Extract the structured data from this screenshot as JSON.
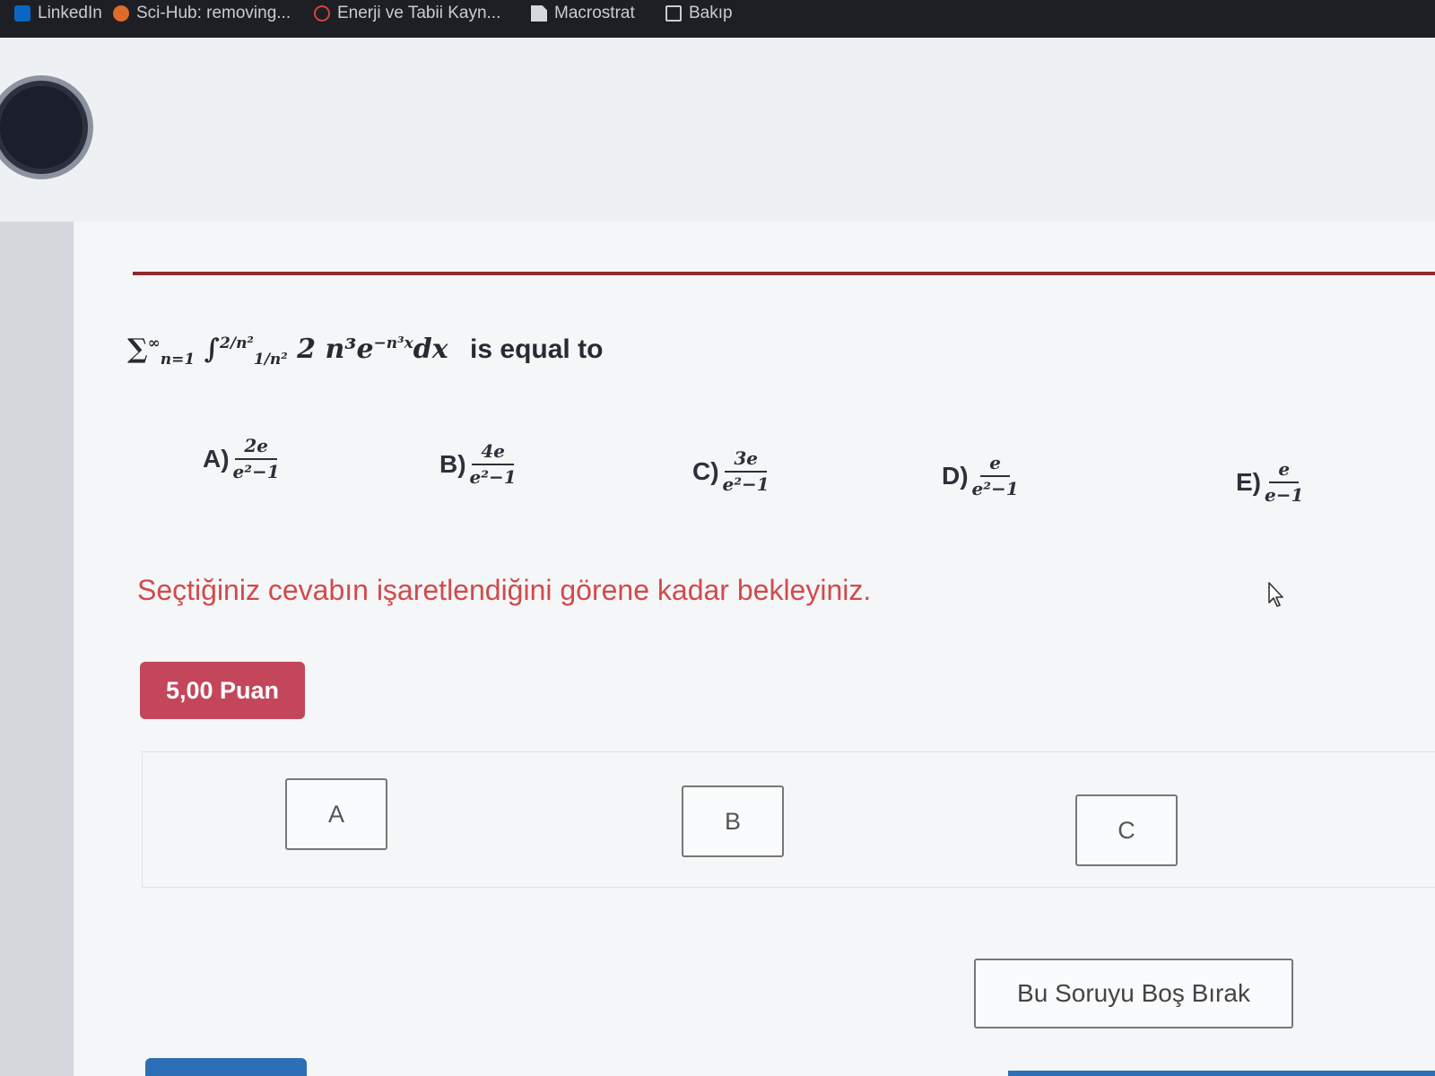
{
  "bookmarks": [
    {
      "label": "LinkedIn",
      "icon": "linkedin-icon"
    },
    {
      "label": "Sci-Hub: removing...",
      "icon": "sci-hub-icon"
    },
    {
      "label": "Enerji ve Tabii Kayn...",
      "icon": "energy-site-icon"
    },
    {
      "label": "Macrostrat",
      "icon": "document-icon"
    },
    {
      "label": "Bakıp",
      "icon": "folder-icon"
    }
  ],
  "question": {
    "sum_symbol": "∑",
    "sum_lower": "n=1",
    "sum_upper": "∞",
    "integral_symbol": "∫",
    "int_lower": "1/n²",
    "int_upper": "2/n²",
    "integrand_coef": "2 n³e",
    "integrand_exp": "−n³x",
    "differential": "dx",
    "tail": "is equal to"
  },
  "options": [
    {
      "letter": "A)",
      "num": "2e",
      "den": "e²−1"
    },
    {
      "letter": "B)",
      "num": "4e",
      "den": "e²−1"
    },
    {
      "letter": "C)",
      "num": "3e",
      "den": "e²−1"
    },
    {
      "letter": "D)",
      "num": "e",
      "den": "e²−1"
    },
    {
      "letter": "E)",
      "num": "e",
      "den": "e−1"
    }
  ],
  "wait_message": "Seçtiğiniz cevabın işaretlendiğini görene kadar bekleyiniz.",
  "points": "5,00 Puan",
  "answer_buttons": [
    "A",
    "B",
    "C"
  ],
  "skip_button": "Bu Soruyu Boş Bırak",
  "colors": {
    "accent_red": "#c4465a",
    "divider": "#8f2a2a",
    "message": "#d24a4a",
    "bookmarks_bg": "#1d1f24",
    "blue": "#2c6fb7"
  }
}
